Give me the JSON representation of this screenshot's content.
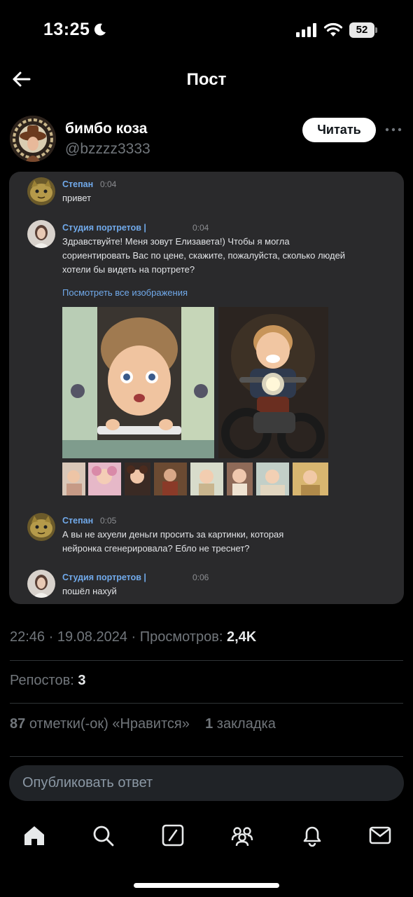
{
  "status_bar": {
    "time": "13:25",
    "battery": "52",
    "icons": [
      "moon-icon",
      "signal-icon",
      "wifi-icon",
      "battery-icon"
    ]
  },
  "header": {
    "title": "Пост",
    "back_icon": "arrow-left-icon"
  },
  "author": {
    "name": "бимбо коза",
    "handle": "@bzzzz3333",
    "follow_label": "Читать",
    "more_icon": "more-horizontal-icon"
  },
  "embedded_chat": {
    "messages": [
      {
        "name": "Степан",
        "time": "0:04",
        "text": "привет"
      },
      {
        "name": "Студия портретов |",
        "time": "0:04",
        "text": "Здравствуйте! Меня зовут Елизавета!) Чтобы я могла сориентировать Вас по цене, скажите, пожалуйста, сколько людей хотели бы видеть на портрете?"
      },
      {
        "name": "Степан",
        "time": "0:05",
        "text": "А вы не ахуели деньги просить за картинки, которая нейронка сгенерировала? Ебло не треснет?"
      },
      {
        "name": "Студия портретов |",
        "time": "0:06",
        "text": "пошёл нахуй"
      }
    ],
    "view_all_link": "Посмотреть все изображения"
  },
  "meta": {
    "time": "22:46",
    "date": "19.08.2024",
    "views_label": "Просмотров:",
    "views": "2,4K",
    "reposts_label": "Репостов:",
    "reposts": "3",
    "likes": "87",
    "likes_label": "отметки(-ок) «Нравится»",
    "bookmarks": "1",
    "bookmarks_label": "закладка"
  },
  "reply": {
    "placeholder": "Опубликовать ответ"
  },
  "nav": [
    "home-icon",
    "search-icon",
    "compose-icon",
    "communities-icon",
    "notifications-icon",
    "messages-icon"
  ],
  "colors": {
    "background": "#000000",
    "card": "#2a2a2c",
    "link": "#71aaeb",
    "muted": "#71767b"
  }
}
